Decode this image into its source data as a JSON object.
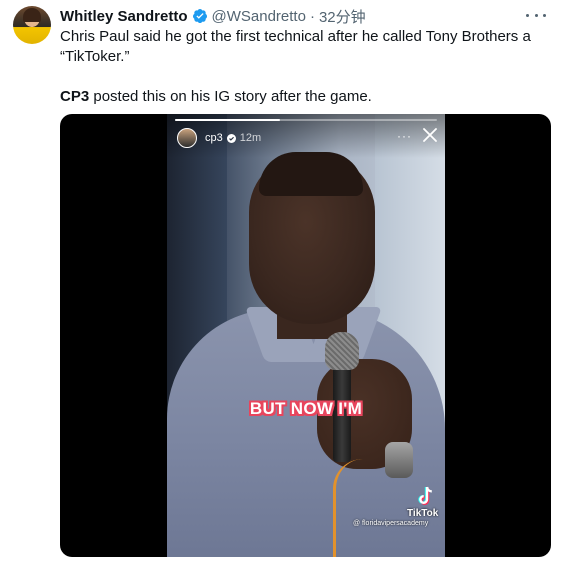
{
  "tweet": {
    "author_name": "Whitley Sandretto",
    "handle": "@WSandretto",
    "separator": "·",
    "time": "32分钟",
    "text_line1": "Chris Paul said he got the first technical after he called Tony Brothers a “TikToker.”",
    "mention": "CP3",
    "text_line2_rest": " posted this on his IG story after the game."
  },
  "media": {
    "story": {
      "username": "cp3",
      "time": "12m",
      "more": "···"
    },
    "caption": "BUT NOW I'M",
    "watermark": {
      "brand": "TikTok",
      "handle": "@ floridavipersacademy"
    }
  },
  "colors": {
    "verified": "#1d9bf0",
    "caption_outline": "#e8455d",
    "secondary_text": "#536471"
  }
}
